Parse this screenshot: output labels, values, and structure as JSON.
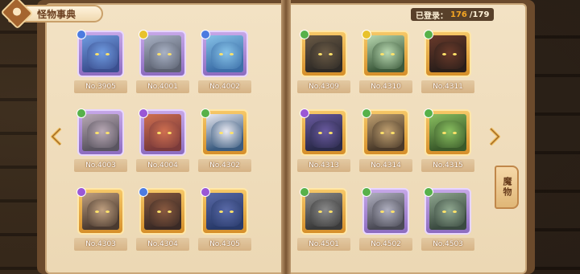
{
  "header": {
    "title": "怪物事典",
    "recorded_label": "已登录：",
    "recorded_count": "176",
    "total_count": "/179"
  },
  "side_tab": {
    "label": "魔物"
  },
  "left_page": {
    "cards": [
      {
        "id": "No.3905",
        "frame": "purple",
        "element": "blue"
      },
      {
        "id": "No.4001",
        "frame": "purple",
        "element": "yellow"
      },
      {
        "id": "No.4002",
        "frame": "purple",
        "element": "blue"
      },
      {
        "id": "No.4003",
        "frame": "purple",
        "element": "green"
      },
      {
        "id": "No.4004",
        "frame": "purple",
        "element": "purple"
      },
      {
        "id": "No.4302",
        "frame": "gold",
        "element": "green"
      },
      {
        "id": "No.4303",
        "frame": "gold",
        "element": "purple"
      },
      {
        "id": "No.4304",
        "frame": "gold",
        "element": "blue"
      },
      {
        "id": "No.4305",
        "frame": "gold",
        "element": "purple"
      }
    ]
  },
  "right_page": {
    "cards": [
      {
        "id": "No.4309",
        "frame": "gold",
        "element": "green"
      },
      {
        "id": "No.4310",
        "frame": "gold",
        "element": "yellow"
      },
      {
        "id": "No.4311",
        "frame": "gold",
        "element": "green"
      },
      {
        "id": "No.4313",
        "frame": "gold",
        "element": "purple"
      },
      {
        "id": "No.4314",
        "frame": "gold",
        "element": "green"
      },
      {
        "id": "No.4315",
        "frame": "gold",
        "element": "green"
      },
      {
        "id": "No.4501",
        "frame": "gold",
        "element": "green"
      },
      {
        "id": "No.4502",
        "frame": "purple",
        "element": "green"
      },
      {
        "id": "No.4503",
        "frame": "purple",
        "element": "green"
      }
    ]
  },
  "colors": {
    "accent": "#f5a623",
    "page": "#f0dcb9",
    "label_text": "#ffffff"
  },
  "icons": {
    "prev": "chevron-left-icon",
    "next": "chevron-right-icon",
    "title_emblem": "book-emblem-icon"
  }
}
